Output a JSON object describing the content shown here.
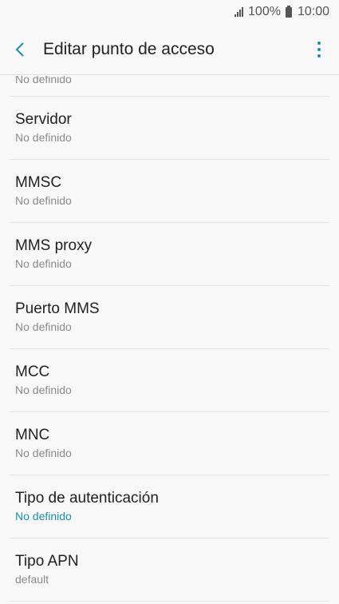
{
  "status_bar": {
    "battery": "100%",
    "time": "10:00"
  },
  "app_bar": {
    "title": "Editar punto de acceso",
    "back_icon": "chevron-left-icon",
    "more_icon": "more-vert-icon",
    "accent_color": "#1a8fa9"
  },
  "partial_item": {
    "value": "No definido"
  },
  "items": [
    {
      "title": "Servidor",
      "value": "No definido"
    },
    {
      "title": "MMSC",
      "value": "No definido"
    },
    {
      "title": "MMS proxy",
      "value": "No definido"
    },
    {
      "title": "Puerto MMS",
      "value": "No definido"
    },
    {
      "title": "MCC",
      "value": "No definido"
    },
    {
      "title": "MNC",
      "value": "No definido"
    },
    {
      "title": "Tipo de autenticación",
      "value": "No definido"
    },
    {
      "title": "Tipo APN",
      "value": "default"
    }
  ]
}
